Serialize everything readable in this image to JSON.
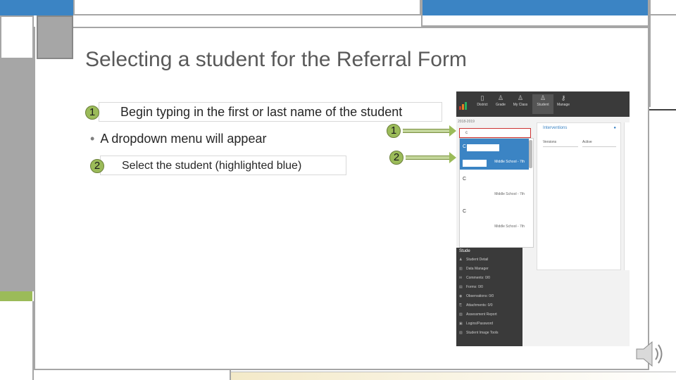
{
  "slide": {
    "title": "Selecting a student for the Referral Form",
    "step1": {
      "number": "1",
      "text": "Begin typing in the first or last name of the student"
    },
    "bullet": "A dropdown menu will appear",
    "step2": {
      "number": "2",
      "text": "Select the student (highlighted blue)"
    },
    "callout1": "1",
    "callout2": "2"
  },
  "app": {
    "nav": [
      {
        "label": "District",
        "icon": "building-icon"
      },
      {
        "label": "Grade",
        "icon": "users-icon"
      },
      {
        "label": "My Class",
        "icon": "users-icon"
      },
      {
        "label": "Student",
        "icon": "user-icon"
      },
      {
        "label": "Manage",
        "icon": "key-icon"
      }
    ],
    "year": "2018-2019",
    "search_value": "c",
    "dropdown": [
      {
        "name": "C",
        "school": "Middle School - 7th"
      },
      {
        "name": "C",
        "school": "Middle School - 7th"
      },
      {
        "name": "C",
        "school": "Middle School - 7th"
      }
    ],
    "panel": {
      "title": "Interventions",
      "select1": "Versions",
      "select2": "Active"
    },
    "sidebar_header": "Stude",
    "sidebar": [
      "Student Detail",
      "Data Manager",
      "Comments: 0/0",
      "Forms: 0/0",
      "Observations: 0/0",
      "Attachments: 0/0",
      "Assessment Report",
      "Logins/Password",
      "Student Image Tools"
    ],
    "colors": {
      "accent_blue": "#3b84c4",
      "badge_green": "#9bbb59",
      "dark_bar": "#3a3a3a"
    }
  }
}
